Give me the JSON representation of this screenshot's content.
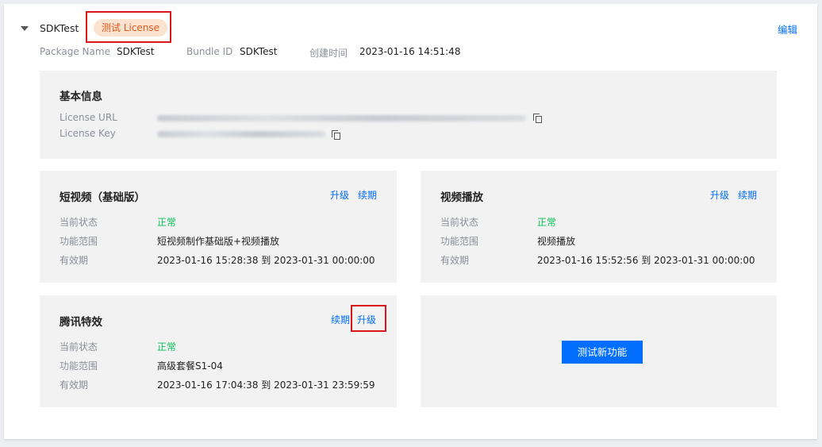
{
  "header": {
    "app_name": "SDKTest",
    "license_tag": "测试 License",
    "edit_label": "编辑",
    "package_name_label": "Package Name",
    "package_name_value": "SDKTest",
    "bundle_id_label": "Bundle ID",
    "bundle_id_value": "SDKTest",
    "created_label": "创建时间",
    "created_value": "2023-01-16 14:51:48"
  },
  "basic_info": {
    "title": "基本信息",
    "license_url_label": "License URL",
    "license_key_label": "License Key"
  },
  "short_video": {
    "title": "短视频（基础版）",
    "upgrade_label": "升级",
    "renew_label": "续期",
    "status_label": "当前状态",
    "status_value": "正常",
    "scope_label": "功能范围",
    "scope_value": "短视频制作基础版+视频播放",
    "validity_label": "有效期",
    "validity_value": "2023-01-16 15:28:38 到 2023-01-31 00:00:00"
  },
  "video_play": {
    "title": "视频播放",
    "upgrade_label": "升级",
    "renew_label": "续期",
    "status_label": "当前状态",
    "status_value": "正常",
    "scope_label": "功能范围",
    "scope_value": "视频播放",
    "validity_label": "有效期",
    "validity_value": "2023-01-16 15:52:56 到 2023-01-31 00:00:00"
  },
  "effects": {
    "title": "腾讯特效",
    "renew_label": "续期",
    "upgrade_label": "升级",
    "status_label": "当前状态",
    "status_value": "正常",
    "scope_label": "功能范围",
    "scope_value": "高级套餐S1-04",
    "validity_label": "有效期",
    "validity_value": "2023-01-16 17:04:38 到 2023-01-31 23:59:59"
  },
  "new_feature": {
    "button_label": "测试新功能"
  },
  "colors": {
    "accent": "#006eff",
    "status_ok": "#0abf5b",
    "tag_bg": "#fce3cf",
    "tag_text": "#e0561b",
    "highlight_border": "#d9161a",
    "card_bg": "#f2f2f2"
  },
  "icons": [
    "caret-down-icon",
    "copy-icon"
  ]
}
